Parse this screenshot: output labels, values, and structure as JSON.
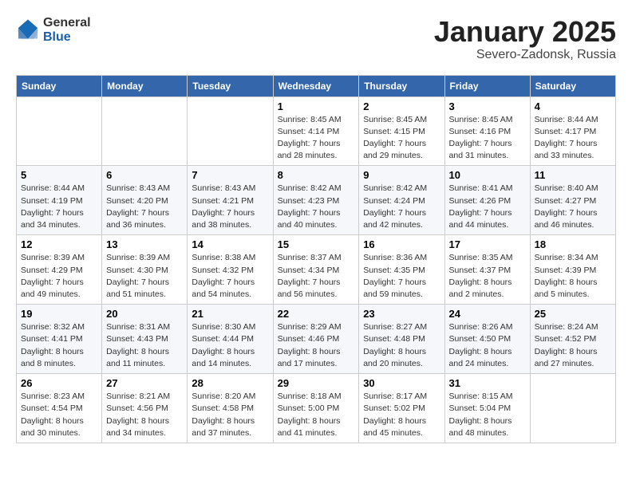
{
  "header": {
    "logo_general": "General",
    "logo_blue": "Blue",
    "month_title": "January 2025",
    "location": "Severo-Zadonsk, Russia"
  },
  "weekdays": [
    "Sunday",
    "Monday",
    "Tuesday",
    "Wednesday",
    "Thursday",
    "Friday",
    "Saturday"
  ],
  "weeks": [
    [
      {
        "day": "",
        "info": ""
      },
      {
        "day": "",
        "info": ""
      },
      {
        "day": "",
        "info": ""
      },
      {
        "day": "1",
        "info": "Sunrise: 8:45 AM\nSunset: 4:14 PM\nDaylight: 7 hours\nand 28 minutes."
      },
      {
        "day": "2",
        "info": "Sunrise: 8:45 AM\nSunset: 4:15 PM\nDaylight: 7 hours\nand 29 minutes."
      },
      {
        "day": "3",
        "info": "Sunrise: 8:45 AM\nSunset: 4:16 PM\nDaylight: 7 hours\nand 31 minutes."
      },
      {
        "day": "4",
        "info": "Sunrise: 8:44 AM\nSunset: 4:17 PM\nDaylight: 7 hours\nand 33 minutes."
      }
    ],
    [
      {
        "day": "5",
        "info": "Sunrise: 8:44 AM\nSunset: 4:19 PM\nDaylight: 7 hours\nand 34 minutes."
      },
      {
        "day": "6",
        "info": "Sunrise: 8:43 AM\nSunset: 4:20 PM\nDaylight: 7 hours\nand 36 minutes."
      },
      {
        "day": "7",
        "info": "Sunrise: 8:43 AM\nSunset: 4:21 PM\nDaylight: 7 hours\nand 38 minutes."
      },
      {
        "day": "8",
        "info": "Sunrise: 8:42 AM\nSunset: 4:23 PM\nDaylight: 7 hours\nand 40 minutes."
      },
      {
        "day": "9",
        "info": "Sunrise: 8:42 AM\nSunset: 4:24 PM\nDaylight: 7 hours\nand 42 minutes."
      },
      {
        "day": "10",
        "info": "Sunrise: 8:41 AM\nSunset: 4:26 PM\nDaylight: 7 hours\nand 44 minutes."
      },
      {
        "day": "11",
        "info": "Sunrise: 8:40 AM\nSunset: 4:27 PM\nDaylight: 7 hours\nand 46 minutes."
      }
    ],
    [
      {
        "day": "12",
        "info": "Sunrise: 8:39 AM\nSunset: 4:29 PM\nDaylight: 7 hours\nand 49 minutes."
      },
      {
        "day": "13",
        "info": "Sunrise: 8:39 AM\nSunset: 4:30 PM\nDaylight: 7 hours\nand 51 minutes."
      },
      {
        "day": "14",
        "info": "Sunrise: 8:38 AM\nSunset: 4:32 PM\nDaylight: 7 hours\nand 54 minutes."
      },
      {
        "day": "15",
        "info": "Sunrise: 8:37 AM\nSunset: 4:34 PM\nDaylight: 7 hours\nand 56 minutes."
      },
      {
        "day": "16",
        "info": "Sunrise: 8:36 AM\nSunset: 4:35 PM\nDaylight: 7 hours\nand 59 minutes."
      },
      {
        "day": "17",
        "info": "Sunrise: 8:35 AM\nSunset: 4:37 PM\nDaylight: 8 hours\nand 2 minutes."
      },
      {
        "day": "18",
        "info": "Sunrise: 8:34 AM\nSunset: 4:39 PM\nDaylight: 8 hours\nand 5 minutes."
      }
    ],
    [
      {
        "day": "19",
        "info": "Sunrise: 8:32 AM\nSunset: 4:41 PM\nDaylight: 8 hours\nand 8 minutes."
      },
      {
        "day": "20",
        "info": "Sunrise: 8:31 AM\nSunset: 4:43 PM\nDaylight: 8 hours\nand 11 minutes."
      },
      {
        "day": "21",
        "info": "Sunrise: 8:30 AM\nSunset: 4:44 PM\nDaylight: 8 hours\nand 14 minutes."
      },
      {
        "day": "22",
        "info": "Sunrise: 8:29 AM\nSunset: 4:46 PM\nDaylight: 8 hours\nand 17 minutes."
      },
      {
        "day": "23",
        "info": "Sunrise: 8:27 AM\nSunset: 4:48 PM\nDaylight: 8 hours\nand 20 minutes."
      },
      {
        "day": "24",
        "info": "Sunrise: 8:26 AM\nSunset: 4:50 PM\nDaylight: 8 hours\nand 24 minutes."
      },
      {
        "day": "25",
        "info": "Sunrise: 8:24 AM\nSunset: 4:52 PM\nDaylight: 8 hours\nand 27 minutes."
      }
    ],
    [
      {
        "day": "26",
        "info": "Sunrise: 8:23 AM\nSunset: 4:54 PM\nDaylight: 8 hours\nand 30 minutes."
      },
      {
        "day": "27",
        "info": "Sunrise: 8:21 AM\nSunset: 4:56 PM\nDaylight: 8 hours\nand 34 minutes."
      },
      {
        "day": "28",
        "info": "Sunrise: 8:20 AM\nSunset: 4:58 PM\nDaylight: 8 hours\nand 37 minutes."
      },
      {
        "day": "29",
        "info": "Sunrise: 8:18 AM\nSunset: 5:00 PM\nDaylight: 8 hours\nand 41 minutes."
      },
      {
        "day": "30",
        "info": "Sunrise: 8:17 AM\nSunset: 5:02 PM\nDaylight: 8 hours\nand 45 minutes."
      },
      {
        "day": "31",
        "info": "Sunrise: 8:15 AM\nSunset: 5:04 PM\nDaylight: 8 hours\nand 48 minutes."
      },
      {
        "day": "",
        "info": ""
      }
    ]
  ]
}
